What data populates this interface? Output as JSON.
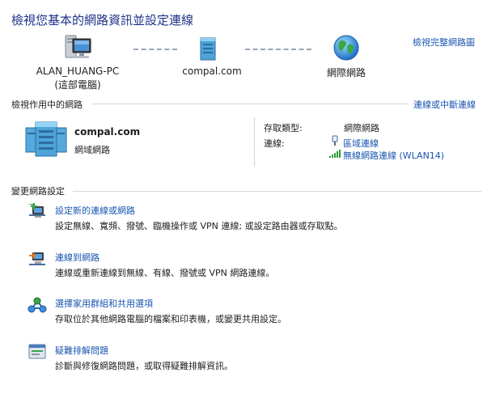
{
  "header": {
    "title": "檢視您基本的網路資訊並設定連線",
    "view_full_map": "檢視完整網路圖"
  },
  "network_map": {
    "computer_name": "ALAN_HUANG-PC",
    "computer_sub": "(這部電腦)",
    "network_name": "compal.com",
    "internet_label": "網際網路"
  },
  "active_networks": {
    "title": "檢視作用中的網路",
    "connect_disconnect_link": "連線或中斷連線",
    "network_name": "compal.com",
    "network_type": "網域網路",
    "access_type_label": "存取類型:",
    "access_type_value": "網際網路",
    "connections_label": "連線:",
    "connections": [
      "區域連線",
      "無線網路連線 (WLAN14)"
    ]
  },
  "change_settings": {
    "title": "變更網路設定",
    "tasks": [
      {
        "title": "設定新的連線或網路",
        "desc": "設定無線、寬頻、撥號、臨機操作或 VPN 連線; 或設定路由器或存取點。"
      },
      {
        "title": "連線到網路",
        "desc": "連線或重新連線到無線、有線、撥號或 VPN 網路連線。"
      },
      {
        "title": "選擇家用群組和共用選項",
        "desc": "存取位於其他網路電腦的檔案和印表機，或變更共用設定。"
      },
      {
        "title": "疑難排解問題",
        "desc": "診斷與修復網路問題，或取得疑難排解資訊。"
      }
    ]
  },
  "colors": {
    "title": "#1e3287",
    "link": "#1a56b0",
    "text": "#1e1e1e",
    "rule": "#d4d8de"
  }
}
